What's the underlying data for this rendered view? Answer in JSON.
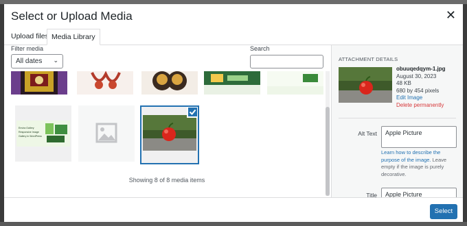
{
  "modal": {
    "title": "Select or Upload Media",
    "close_icon": "close-icon",
    "tabs": [
      {
        "label": "Upload files",
        "active": false
      },
      {
        "label": "Media Library",
        "active": true
      }
    ]
  },
  "toolbar": {
    "filter_label": "Filter media",
    "date_filter_value": "All dates",
    "search_label": "Search",
    "search_value": ""
  },
  "media_grid": {
    "items": [
      {
        "name": "media-item-1",
        "selected": false
      },
      {
        "name": "media-item-2",
        "selected": false
      },
      {
        "name": "media-item-3",
        "selected": false
      },
      {
        "name": "media-item-4",
        "selected": false
      },
      {
        "name": "media-item-5",
        "selected": false
      },
      {
        "name": "media-item-6-banner",
        "selected": false
      },
      {
        "name": "media-item-7-placeholder",
        "selected": false
      },
      {
        "name": "media-item-8-apple",
        "selected": true
      }
    ],
    "banner_caption": "Envira Gallery\nResponsive Image\nGallery in WordPress",
    "status_text": "Showing 8 of 8 media items"
  },
  "attachment": {
    "heading": "ATTACHMENT DETAILS",
    "filename": "obuuqedqym-1.jpg",
    "date": "August 30, 2023",
    "size": "48 KB",
    "dimensions": "680 by 454 pixels",
    "edit_link": "Edit Image",
    "delete_link": "Delete permanently",
    "alt_label": "Alt Text",
    "alt_value": "Apple Picture",
    "help_link": "Learn how to describe the purpose of the image.",
    "help_rest": "Leave empty if the image is purely decorative.",
    "title_label": "Title",
    "title_value": "Apple Picture"
  },
  "footer": {
    "select_button": "Select"
  },
  "colors": {
    "accent": "#2271b1",
    "danger": "#d63638",
    "sidebar_bg": "#f6f7f7"
  }
}
